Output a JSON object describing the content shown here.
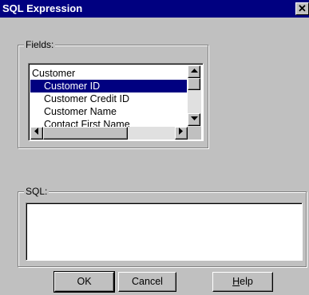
{
  "window": {
    "title": "SQL Expression",
    "close_glyph": "✕"
  },
  "fields": {
    "label": "Fields:",
    "items": [
      {
        "label": "Customer",
        "level": 0,
        "selected": false
      },
      {
        "label": "Customer ID",
        "level": 1,
        "selected": true
      },
      {
        "label": "Customer Credit ID",
        "level": 1,
        "selected": false
      },
      {
        "label": "Customer Name",
        "level": 1,
        "selected": false
      },
      {
        "label": "Contact First Name",
        "level": 1,
        "selected": false
      }
    ]
  },
  "sql": {
    "label": "SQL:",
    "value": ""
  },
  "buttons": {
    "ok": "OK",
    "cancel": "Cancel",
    "help_mnemonic": "H",
    "help_rest": "elp"
  },
  "icons": {
    "up": "up-arrow-icon",
    "down": "down-arrow-icon",
    "left": "left-arrow-icon",
    "right": "right-arrow-icon",
    "close": "close-icon"
  },
  "colors": {
    "titlebar": "#000080",
    "selection": "#000080",
    "face": "#c0c0c0"
  }
}
